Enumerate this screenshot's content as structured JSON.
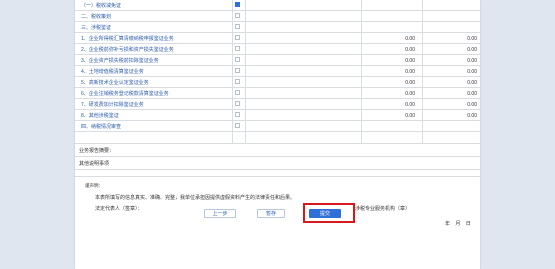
{
  "rows": [
    {
      "label": "（一）税收减免证",
      "checked": true,
      "v1": "",
      "v2": ""
    },
    {
      "label": "二、税收策划",
      "checked": false,
      "v1": "",
      "v2": ""
    },
    {
      "label": "三、涉税鉴证",
      "checked": false,
      "v1": "",
      "v2": ""
    },
    {
      "label": "1、企业所得税汇算清缴纳税申报鉴证业务",
      "checked": false,
      "v1": "0.00",
      "v2": "0.00"
    },
    {
      "label": "2、企业税前弥补亏损和资产损失鉴证业务",
      "checked": false,
      "v1": "0.00",
      "v2": "0.00"
    },
    {
      "label": "3、企业资产损失税前扣除鉴证业务",
      "checked": false,
      "v1": "0.00",
      "v2": "0.00"
    },
    {
      "label": "4、土地增值税清算鉴证业务",
      "checked": false,
      "v1": "0.00",
      "v2": "0.00"
    },
    {
      "label": "5、高新技术企业认定鉴证业务",
      "checked": false,
      "v1": "0.00",
      "v2": "0.00"
    },
    {
      "label": "6、企业注销税务登记税款清算鉴证业务",
      "checked": false,
      "v1": "0.00",
      "v2": "0.00"
    },
    {
      "label": "7、研发费加计扣除鉴证业务",
      "checked": false,
      "v1": "0.00",
      "v2": "0.00"
    },
    {
      "label": "8、其他涉税鉴证",
      "checked": false,
      "v1": "0.00",
      "v2": "0.00"
    },
    {
      "label": "四、纳税情况审查",
      "checked": false,
      "v1": "",
      "v2": ""
    }
  ],
  "section": {
    "business_report": "业务报告摘要：",
    "remarks": "其他说明事项"
  },
  "declaration": {
    "title": "谨声明：",
    "body": "本表所填写的信息真实、准确、完整，我单位承担因提供虚假资料产生的法律责任和后果。",
    "legal_rep": "法定代表人（签章）：",
    "agency": "涉税专业服务机构（章）",
    "date": "年  月  日"
  },
  "buttons": {
    "prev": "上一步",
    "save": "暂存",
    "submit": "提交"
  },
  "colors": {
    "accent": "#2f6fd8",
    "highlight": "#d7191c"
  }
}
